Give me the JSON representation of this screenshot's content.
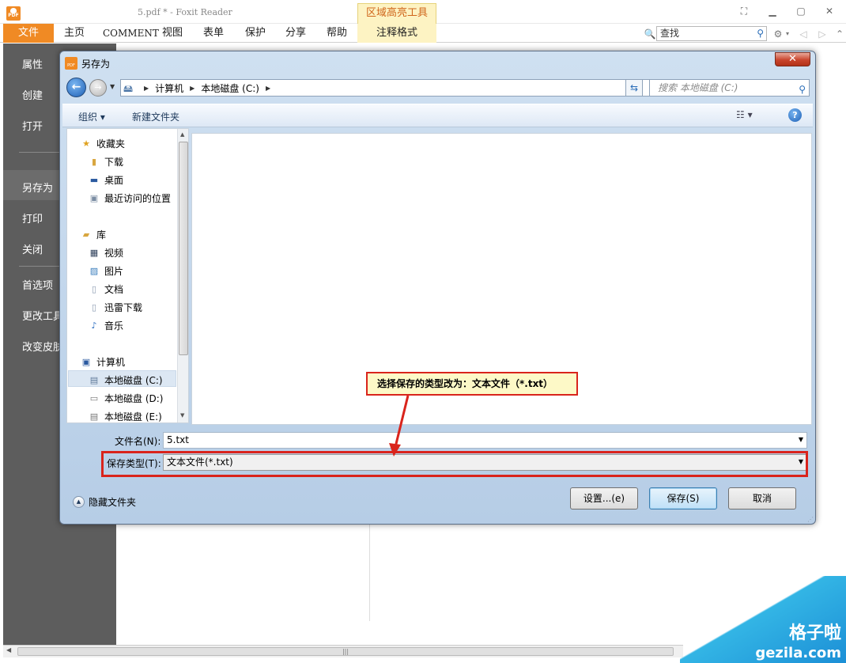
{
  "app": {
    "logo_text": "PDF",
    "window_title": "5.pdf * - Foxit Reader",
    "context_tab": "区域高亮工具",
    "context_subtab": "注释格式"
  },
  "menu": {
    "file": "文件",
    "items": [
      "主页",
      "COMMENT",
      "视图",
      "表单",
      "保护",
      "分享",
      "帮助"
    ]
  },
  "toolbar_search": {
    "placeholder": "查找"
  },
  "left_panel": {
    "items": [
      "属性",
      "创建",
      "打开",
      "另存为",
      "打印",
      "关闭",
      "首选项",
      "更改工具",
      "改变皮肤"
    ]
  },
  "dialog": {
    "title": "另存为",
    "address": {
      "segments": [
        "计算机",
        "本地磁盘 (C:)"
      ]
    },
    "search_placeholder": "搜索 本地磁盘 (C:)",
    "commands": {
      "organize": "组织 ▾",
      "new_folder": "新建文件夹"
    },
    "nav": {
      "favorites": "收藏夹",
      "downloads": "下载",
      "desktop": "桌面",
      "recent": "最近访问的位置",
      "libraries": "库",
      "videos": "视频",
      "pictures": "图片",
      "documents": "文档",
      "xunlei": "迅雷下载",
      "music": "音乐",
      "computer": "计算机",
      "drive_c": "本地磁盘 (C:)",
      "drive_d": "本地磁盘 (D:)",
      "drive_e": "本地磁盘 (E:)"
    },
    "filename_label": "文件名(N):",
    "filename_value": "5.txt",
    "filetype_label": "保存类型(T):",
    "filetype_value": "文本文件(*.txt)",
    "hide_folders": "隐藏文件夹",
    "buttons": {
      "settings": "设置...(e)",
      "save": "保存(S)",
      "cancel": "取消"
    }
  },
  "annotation": {
    "text": "选择保存的类型改为：文本文件（*.txt）",
    "color": "#d9241c"
  },
  "watermark": {
    "line1": "格子啦",
    "line2": "gezila.com"
  }
}
